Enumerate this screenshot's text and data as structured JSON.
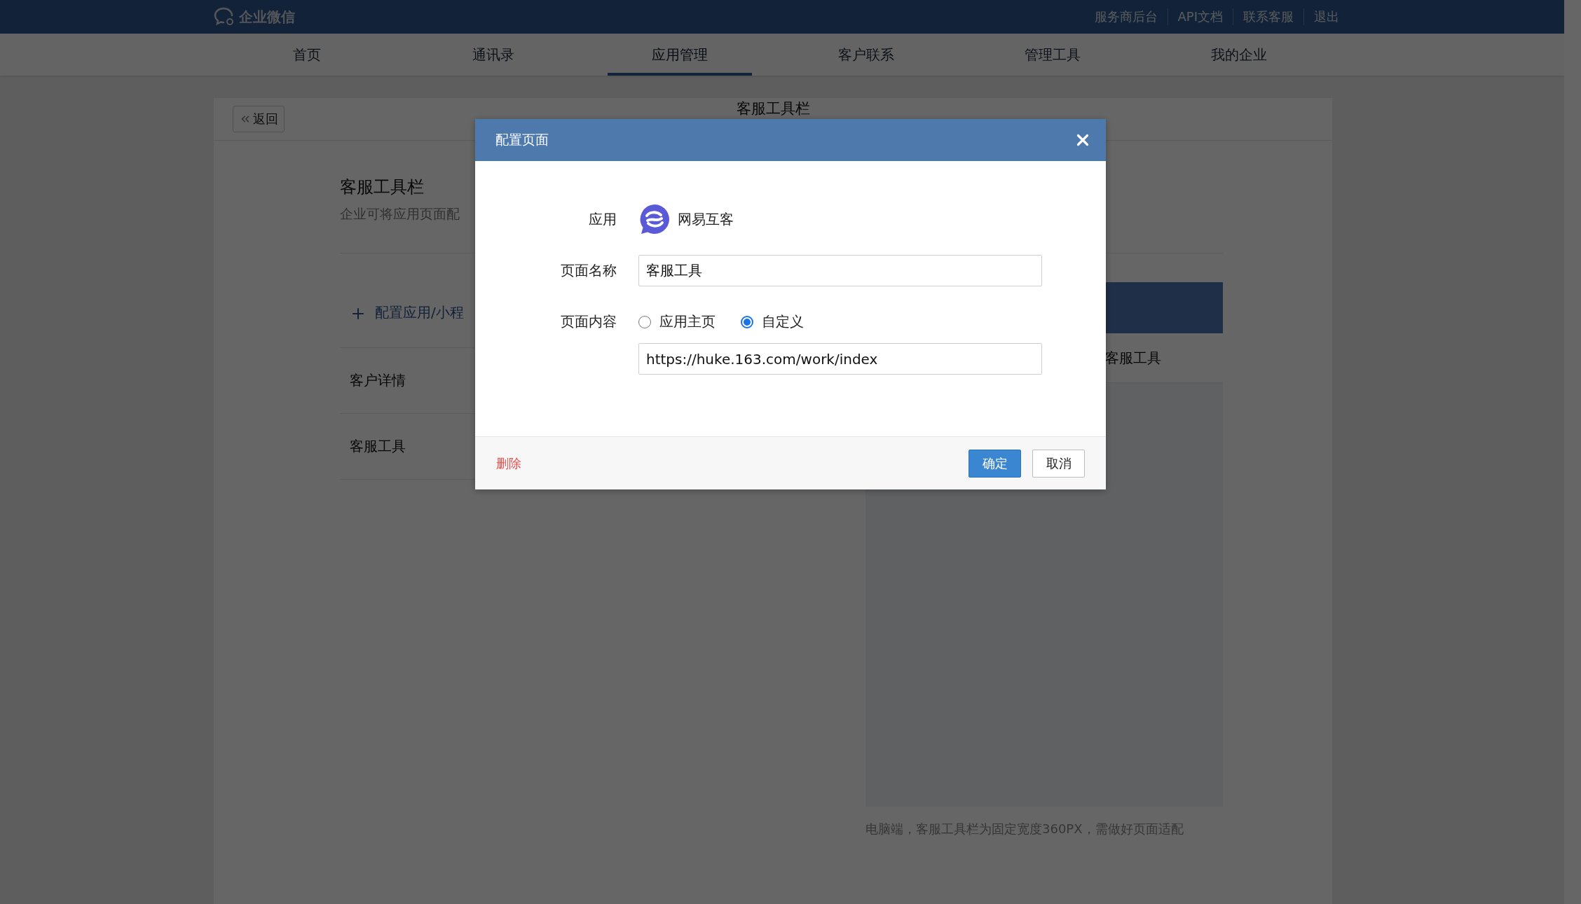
{
  "top_bar": {
    "logo": "企业微信",
    "links": [
      "服务商后台",
      "API文档",
      "联系客服",
      "退出"
    ]
  },
  "nav": [
    {
      "label": "首页",
      "selected": false
    },
    {
      "label": "通讯录",
      "selected": false
    },
    {
      "label": "应用管理",
      "selected": true
    },
    {
      "label": "客户联系",
      "selected": false
    },
    {
      "label": "管理工具",
      "selected": false
    },
    {
      "label": "我的企业",
      "selected": false
    }
  ],
  "page": {
    "back_button": "返回",
    "title": "客服工具栏",
    "heading": "客服工具栏",
    "description": "企业可将应用页面配",
    "add_item": "配置应用/小程",
    "items": [
      "客户详情",
      "客服工具"
    ],
    "preview": {
      "tab": "客服工具",
      "caption": "电脑端，客服工具栏为固定宽度360PX，需做好页面适配"
    }
  },
  "dialog": {
    "title": "配置页面",
    "fields": [
      {
        "kind": "app",
        "label": "应用",
        "value": "网易互客"
      },
      {
        "kind": "text",
        "label": "页面名称",
        "value": "客服工具"
      },
      {
        "kind": "radio",
        "label": "页面内容",
        "options": [
          {
            "label": "应用主页",
            "selected": false
          },
          {
            "label": "自定义",
            "selected": true
          }
        ]
      },
      {
        "kind": "text",
        "value": "https://huke.163.com/work/index"
      }
    ],
    "delete": "删除",
    "buttons": [
      {
        "label": "确定",
        "kind": "primary"
      },
      {
        "label": "取消",
        "kind": "default"
      }
    ]
  }
}
